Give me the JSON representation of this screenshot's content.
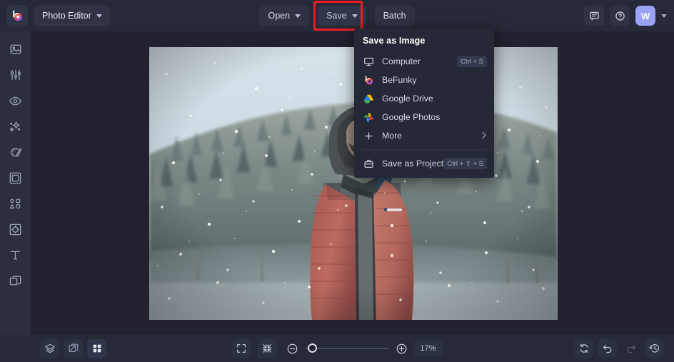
{
  "header": {
    "logo_icon": "befunky-logo-icon",
    "app_selector": {
      "label": "Photo Editor",
      "icon": "chevron-down-icon"
    },
    "buttons": [
      {
        "name": "open-button",
        "label": "Open",
        "has_chevron": true,
        "highlighted": false
      },
      {
        "name": "save-button",
        "label": "Save",
        "has_chevron": true,
        "highlighted": true
      },
      {
        "name": "batch-button",
        "label": "Batch",
        "has_chevron": false,
        "highlighted": false
      }
    ],
    "highlight_color": "#ee1b24",
    "right_icons": [
      {
        "name": "feedback-icon",
        "title": "Feedback"
      },
      {
        "name": "help-icon",
        "title": "Help"
      }
    ],
    "avatar": {
      "initial": "W",
      "color": "#9aa3f5"
    },
    "avatar_chevron_icon": "chevron-down-icon"
  },
  "sidebar": {
    "items": [
      {
        "name": "sidebar-item-image-manager",
        "icon": "image-icon"
      },
      {
        "name": "sidebar-item-edit",
        "icon": "sliders-icon"
      },
      {
        "name": "sidebar-item-touch-up",
        "icon": "eye-icon"
      },
      {
        "name": "sidebar-item-effects",
        "icon": "sparkles-icon"
      },
      {
        "name": "sidebar-item-artsy",
        "icon": "palette-icon"
      },
      {
        "name": "sidebar-item-frames",
        "icon": "frame-icon"
      },
      {
        "name": "sidebar-item-graphics",
        "icon": "shapes-icon"
      },
      {
        "name": "sidebar-item-textures",
        "icon": "texture-icon"
      },
      {
        "name": "sidebar-item-text",
        "icon": "text-icon"
      },
      {
        "name": "sidebar-item-layers",
        "icon": "layers-stack-icon"
      }
    ]
  },
  "save_menu": {
    "title": "Save as Image",
    "items": [
      {
        "name": "menu-item-computer",
        "label": "Computer",
        "icon": "monitor-icon",
        "shortcut": "Ctrl + S",
        "submenu": false
      },
      {
        "name": "menu-item-befunky",
        "label": "BeFunky",
        "icon": "befunky-logo-icon",
        "shortcut": "",
        "submenu": false
      },
      {
        "name": "menu-item-google-drive",
        "label": "Google Drive",
        "icon": "google-drive-icon",
        "shortcut": "",
        "submenu": false
      },
      {
        "name": "menu-item-google-photos",
        "label": "Google Photos",
        "icon": "google-photos-icon",
        "shortcut": "",
        "submenu": false
      },
      {
        "name": "menu-item-more",
        "label": "More",
        "icon": "plus-icon",
        "shortcut": "",
        "submenu": true,
        "submenu_icon": "chevron-right-icon"
      }
    ],
    "project_item": {
      "name": "menu-item-save-as-project",
      "label": "Save as Project",
      "icon": "briefcase-icon",
      "shortcut": "Ctrl + ⇧ + S"
    }
  },
  "canvas": {
    "image_alt": "Man in a salmon puffer jacket standing in falling snow with a forested hillside behind"
  },
  "footer": {
    "left_tools": [
      {
        "name": "layers-button",
        "icon": "layers-stack-icon",
        "active": false
      },
      {
        "name": "compare-button",
        "icon": "compare-icon",
        "active": false
      },
      {
        "name": "grid-view-button",
        "icon": "grid-icon",
        "active": true
      }
    ],
    "view_tools": [
      {
        "name": "fit-to-screen-button",
        "icon": "expand-icon"
      },
      {
        "name": "actual-size-button",
        "icon": "collapse-icon"
      }
    ],
    "zoom": {
      "out_icon": "zoom-out-icon",
      "in_icon": "zoom-in-icon",
      "value": "17%",
      "slider_position_pct": 4
    },
    "right_tools": [
      {
        "name": "reset-button",
        "icon": "refresh-icon",
        "enabled": true
      },
      {
        "name": "undo-button",
        "icon": "undo-icon",
        "enabled": true
      },
      {
        "name": "redo-button",
        "icon": "redo-icon",
        "enabled": false
      },
      {
        "name": "history-button",
        "icon": "history-icon",
        "enabled": true
      }
    ]
  }
}
